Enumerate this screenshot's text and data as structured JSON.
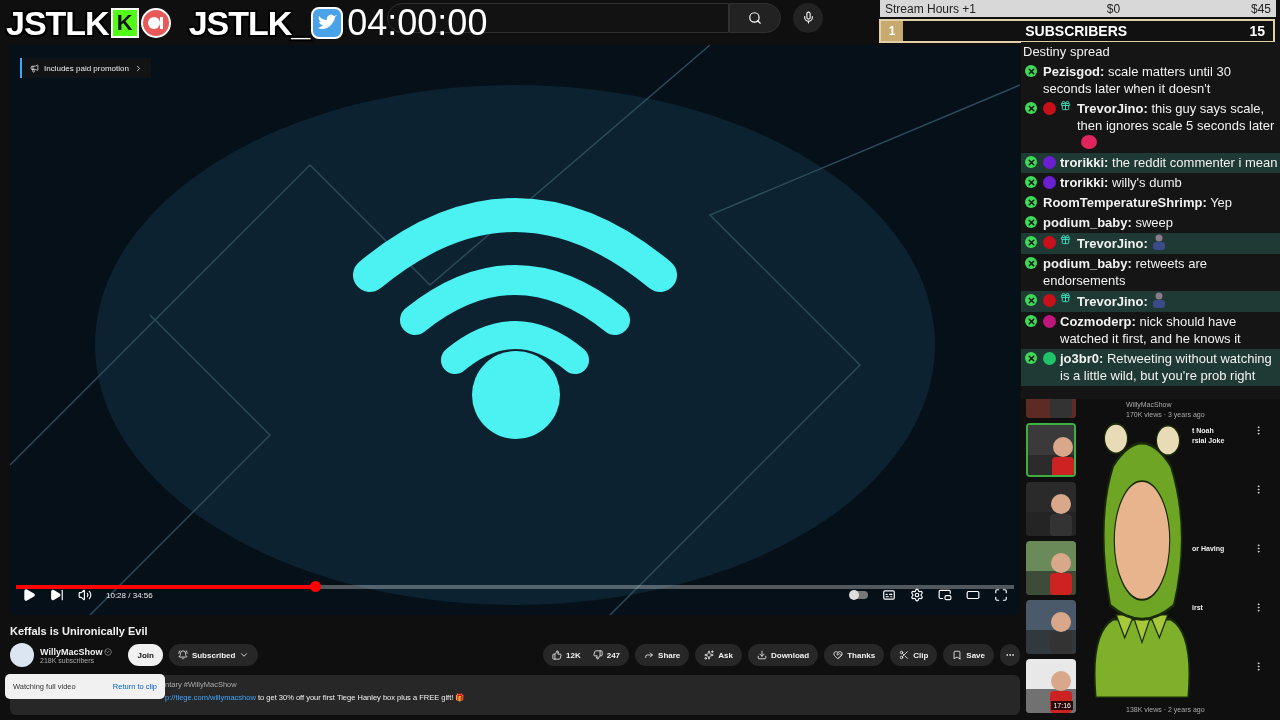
{
  "overlay": {
    "logos": [
      {
        "text": "JSTLK",
        "kind": "kick",
        "badge": "K"
      },
      {
        "text": "JSTLK_",
        "kind": "twitter"
      }
    ],
    "timer": "04:00:00"
  },
  "goal_bar": {
    "label": "Stream Hours +1",
    "current": "$0",
    "target": "$45",
    "level": 0
  },
  "subscribers": {
    "rank": "1",
    "label": "SUBSCRIBERS",
    "count": "15"
  },
  "chat": [
    {
      "text": "Destiny spread",
      "highlighted": false
    },
    {
      "user": "Pezisgod:",
      "text": "scale matters until 30 seconds later when it doesn't",
      "badges": [
        {
          "kind": "mod"
        }
      ],
      "highlighted": false
    },
    {
      "user": "TrevorJino:",
      "text": "this guy says scale, then ignores scale 5 seconds later",
      "badges": [
        {
          "kind": "mod"
        },
        {
          "kind": "orb",
          "color": "#c8101a"
        },
        {
          "kind": "gift"
        }
      ],
      "highlighted": false,
      "emote": {
        "kind": "blob"
      }
    },
    {
      "user": "trorikki:",
      "text": "the reddit commenter i mean",
      "badges": [
        {
          "kind": "mod"
        },
        {
          "kind": "orb",
          "color": "#6a1fd0"
        }
      ],
      "highlighted": true
    },
    {
      "user": "trorikki:",
      "text": "willy's dumb",
      "badges": [
        {
          "kind": "mod"
        },
        {
          "kind": "orb",
          "color": "#6a1fd0"
        }
      ],
      "highlighted": false
    },
    {
      "user": "RoomTemperatureShrimp:",
      "text": "Yep",
      "badges": [
        {
          "kind": "mod"
        }
      ],
      "highlighted": false
    },
    {
      "user": "podium_baby:",
      "text": "sweep",
      "badges": [
        {
          "kind": "mod"
        }
      ],
      "highlighted": false
    },
    {
      "user": "TrevorJino:",
      "badges": [
        {
          "kind": "mod"
        },
        {
          "kind": "orb",
          "color": "#c8101a"
        },
        {
          "kind": "gift"
        }
      ],
      "highlighted": true,
      "emote": {
        "kind": "figure"
      }
    },
    {
      "user": "podium_baby:",
      "text": "retweets are endorsements",
      "badges": [
        {
          "kind": "mod"
        }
      ],
      "highlighted": false
    },
    {
      "user": "TrevorJino:",
      "badges": [
        {
          "kind": "mod"
        },
        {
          "kind": "orb",
          "color": "#c8101a"
        },
        {
          "kind": "gift"
        }
      ],
      "highlighted": true,
      "emote": {
        "kind": "figure"
      }
    },
    {
      "user": "Cozmoderp:",
      "text": "nick should have watched it first, and he knows it",
      "badges": [
        {
          "kind": "mod"
        },
        {
          "kind": "orb",
          "color": "#c0157a"
        }
      ],
      "highlighted": false
    },
    {
      "user": "jo3br0:",
      "text": "Retweeting without watching is a little wild, but you're prob right",
      "badges": [
        {
          "kind": "mod"
        },
        {
          "kind": "orb",
          "color": "#1fc46a"
        }
      ],
      "highlighted": true
    }
  ],
  "video": {
    "promotion": "Includes paid promotion",
    "time": "10:28 / 34:56",
    "progress": {
      "level": 0.3
    },
    "autoplay": {
      "on": false
    }
  },
  "title": "Keffals is Unironically Evil",
  "channel": {
    "name": "WillyMacShow",
    "subscribers": "218K subscribers",
    "join": "Join",
    "subscribed": "Subscribed"
  },
  "actions": {
    "likes": "12K",
    "dislikes": "247",
    "buttons": [
      {
        "kind": "share",
        "label": "Share"
      },
      {
        "kind": "ask",
        "label": "Ask"
      },
      {
        "kind": "download",
        "label": "Download"
      },
      {
        "kind": "thanks",
        "label": "Thanks"
      },
      {
        "kind": "clip",
        "label": "Clip"
      },
      {
        "kind": "save",
        "label": "Save"
      }
    ]
  },
  "description": {
    "line1": "ntary #WillyMacShow",
    "link": "p://tiege.com/willymacshow",
    "line2": "to get 30% off your first Tiege Hanley box plus a FREE gift! 🎁"
  },
  "toast": {
    "text": "Watching full video",
    "action": "Return to clip"
  },
  "recommended": [
    {
      "lines": [
        "WillyMacShow",
        "170K views · 3 years ago"
      ],
      "outlined": false
    },
    {
      "lines": [
        "t Noah",
        "rsial Joke"
      ],
      "outlined": true
    },
    {
      "outlined": false
    },
    {
      "lines": [
        "or Having"
      ],
      "outlined": false
    },
    {
      "lines": [
        "irst"
      ],
      "outlined": false
    },
    {
      "lines": [
        "138K views · 2 years ago"
      ],
      "outlined": false,
      "duration": "17:16"
    }
  ]
}
